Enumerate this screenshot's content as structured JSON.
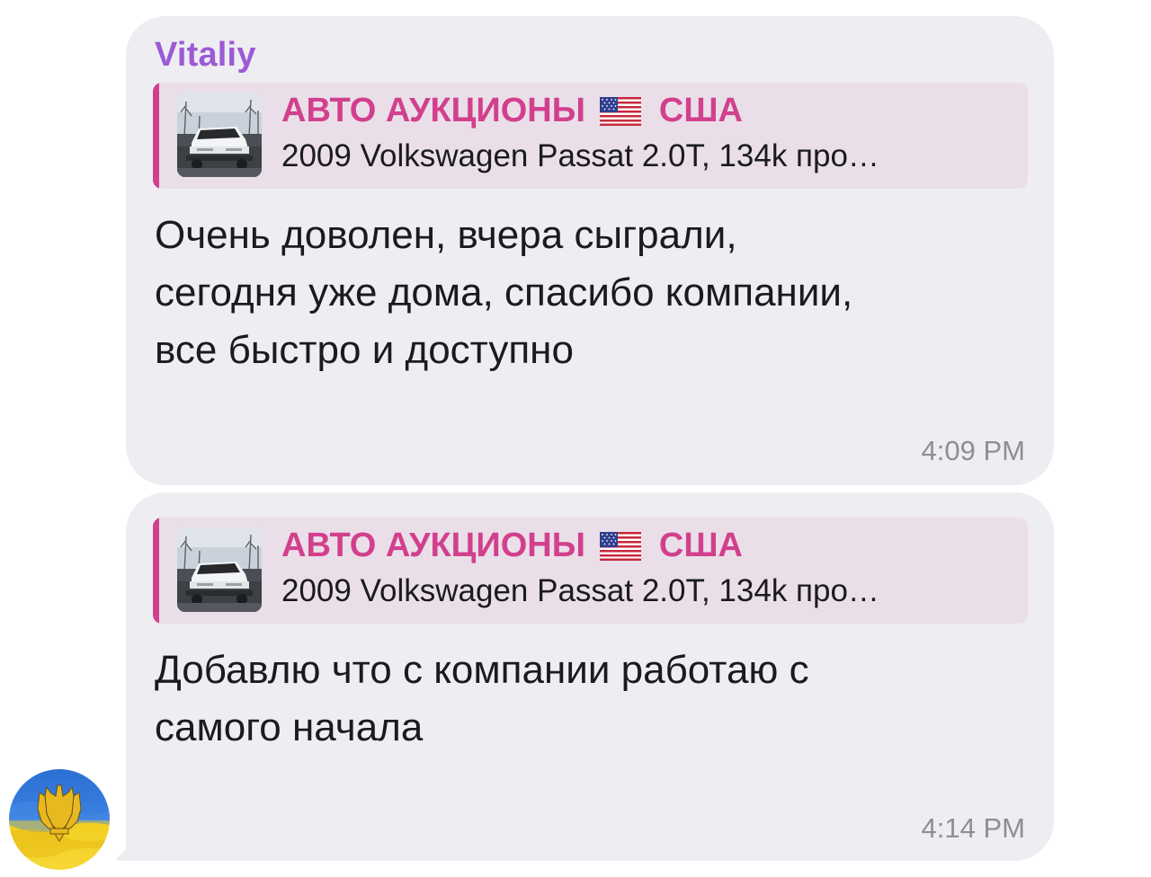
{
  "messages": [
    {
      "sender": "Vitaliy",
      "reply": {
        "title_prefix": "АВТО АУКЦИОНЫ",
        "title_flag": "us-flag-icon",
        "title_suffix": "США",
        "text": "2009 Volkswagen Passat 2.0T, 134k про…",
        "thumbnail": "car-photo"
      },
      "lines": [
        "Очень доволен, вчера сыграли,",
        "сегодня уже дома, спасибо компании,",
        "все быстро и доступно"
      ],
      "time": "4:09 PM"
    },
    {
      "reply": {
        "title_prefix": "АВТО АУКЦИОНЫ",
        "title_flag": "us-flag-icon",
        "title_suffix": "США",
        "text": "2009 Volkswagen Passat 2.0T, 134k про…",
        "thumbnail": "car-photo"
      },
      "lines": [
        "Добавлю что с компании работаю с",
        "самого начала"
      ],
      "time": "4:14 PM"
    }
  ],
  "avatar": {
    "icon": "ukraine-trident-avatar"
  },
  "colors": {
    "bubble": "#eeedf2",
    "sender": "#9c5ad6",
    "reply_accent": "#cf3f8e",
    "reply_background": "#eadfe9",
    "reply_title": "#d2408d",
    "time": "#8f8e94"
  }
}
